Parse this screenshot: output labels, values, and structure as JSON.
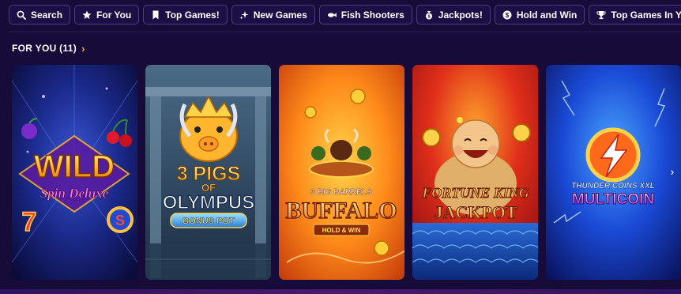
{
  "filters": [
    {
      "label": "Search",
      "icon": "search-icon"
    },
    {
      "label": "For You",
      "icon": "star-icon"
    },
    {
      "label": "Top Games!",
      "icon": "bookmark-icon"
    },
    {
      "label": "New Games",
      "icon": "sparkle-icon"
    },
    {
      "label": "Fish Shooters",
      "icon": "fish-icon"
    },
    {
      "label": "Jackpots!",
      "icon": "moneybag-icon"
    },
    {
      "label": "Hold and Win",
      "icon": "dollar-coin-icon"
    },
    {
      "label": "Top Games In Your State",
      "icon": "trophy-icon"
    }
  ],
  "section": {
    "title": "FOR YOU (11)"
  },
  "games": [
    {
      "logo_line1": "WILD",
      "logo_line2": "Spin Deluxe"
    },
    {
      "logo_line1": "3 PIGS",
      "logo_line2": "OF",
      "logo_line3": "OLYMPUS",
      "logo_line4": "BONUS POT"
    },
    {
      "logo_line1": "3 BIG BARRELS",
      "logo_line2": "BUFFALO",
      "logo_line3": "HOLD & WIN"
    },
    {
      "logo_line1": "FORTUNE KING",
      "logo_line2": "JACKPOT"
    },
    {
      "logo_line1": "THUNDER COINS XXL",
      "logo_line2": "MULTICOIN"
    }
  ],
  "colors": {
    "background": "#170b3a",
    "accent": "#ffb21e",
    "chip_border": "#4a3d78"
  }
}
